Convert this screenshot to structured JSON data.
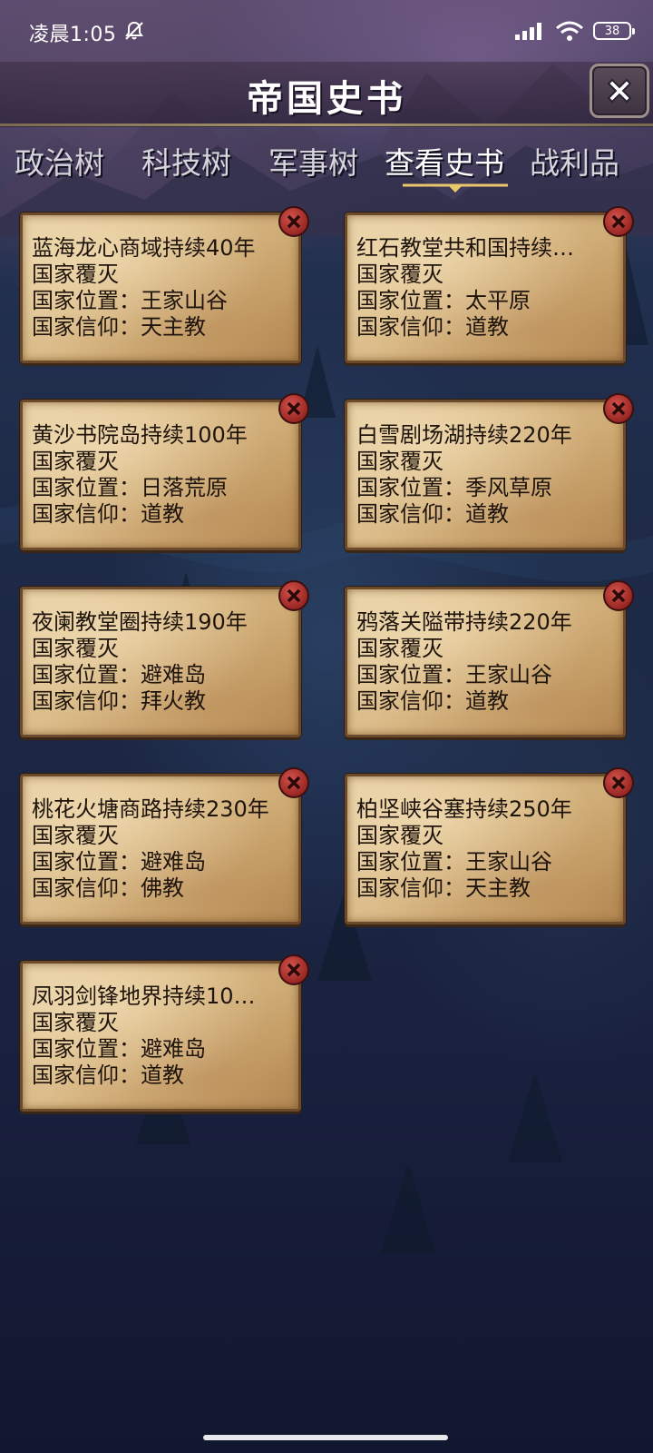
{
  "status_bar": {
    "time": "凌晨1:05",
    "battery": "38"
  },
  "header": {
    "title": "帝国史书"
  },
  "tabs": [
    {
      "label": "政治树",
      "active": false
    },
    {
      "label": "科技树",
      "active": false
    },
    {
      "label": "军事树",
      "active": false
    },
    {
      "label": "查看史书",
      "active": true
    },
    {
      "label": "战利品",
      "active": false
    }
  ],
  "records": [
    {
      "title": "蓝海龙心商域持续40年",
      "status": "国家覆灭",
      "location": "国家位置：王家山谷",
      "faith": "国家信仰：天主教"
    },
    {
      "title": "红石教堂共和国持续…",
      "status": "国家覆灭",
      "location": "国家位置：太平原",
      "faith": "国家信仰：道教"
    },
    {
      "title": "黄沙书院岛持续100年",
      "status": "国家覆灭",
      "location": "国家位置：日落荒原",
      "faith": "国家信仰：道教"
    },
    {
      "title": "白雪剧场湖持续220年",
      "status": "国家覆灭",
      "location": "国家位置：季风草原",
      "faith": "国家信仰：道教"
    },
    {
      "title": "夜阑教堂圈持续190年",
      "status": "国家覆灭",
      "location": "国家位置：避难岛",
      "faith": "国家信仰：拜火教"
    },
    {
      "title": "鸦落关隘带持续220年",
      "status": "国家覆灭",
      "location": "国家位置：王家山谷",
      "faith": "国家信仰：道教"
    },
    {
      "title": "桃花火塘商路持续230年",
      "status": "国家覆灭",
      "location": "国家位置：避难岛",
      "faith": "国家信仰：佛教"
    },
    {
      "title": "柏坚峡谷塞持续250年",
      "status": "国家覆灭",
      "location": "国家位置：王家山谷",
      "faith": "国家信仰：天主教"
    },
    {
      "title": "凤羽剑锋地界持续10…",
      "status": "国家覆灭",
      "location": "国家位置：避难岛",
      "faith": "国家信仰：道教"
    }
  ],
  "icons": {
    "close": "close-icon",
    "delete": "delete-icon",
    "wifi": "wifi-icon",
    "signal": "signal-icon",
    "mute": "bell-off-icon"
  },
  "colors": {
    "parchment": "#d9b985",
    "delete_red": "#9e2a27",
    "accent_gold": "#c8b27a"
  }
}
